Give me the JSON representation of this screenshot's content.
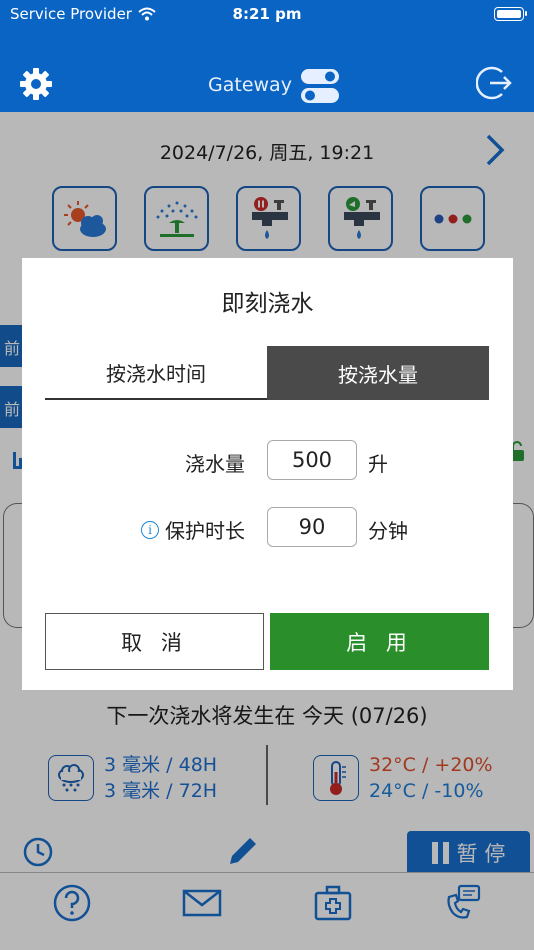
{
  "status_bar": {
    "carrier": "Service Provider",
    "time": "8:21 pm"
  },
  "header": {
    "title": "Gateway"
  },
  "main": {
    "datetime": "2024/7/26, 周五, 19:21",
    "next_watering": "下一次浇水将发生在 今天 (07/26)",
    "rain": [
      "3 毫米 / 48H",
      "3 毫米 / 72H"
    ],
    "temp": [
      "32°C / +20%",
      "24°C / -10%"
    ],
    "pause_label": "暂 停",
    "side_tab_char": "前"
  },
  "dialog": {
    "title": "即刻浇水",
    "tab_time": "按浇水时间",
    "tab_amount": "按浇水量",
    "amount_label": "浇水量",
    "amount_value": "500",
    "amount_unit": "升",
    "protect_label": "保护时长",
    "protect_value": "90",
    "protect_unit": "分钟",
    "cancel": "取 消",
    "enable": "启 用"
  },
  "colors": {
    "header": "#0a64c4",
    "accent": "#1e63b8",
    "enable_green": "#2a8f2a",
    "hot": "#e0502a",
    "cold": "#1e7fd8"
  },
  "icons": {
    "tiles": [
      "weather-sun-cloud-icon",
      "sprinkler-icon",
      "faucet-pause-icon",
      "faucet-run-icon",
      "more-dots-icon"
    ],
    "tabbar": [
      "help-icon",
      "mail-icon",
      "medical-kit-icon",
      "support-icon"
    ]
  }
}
